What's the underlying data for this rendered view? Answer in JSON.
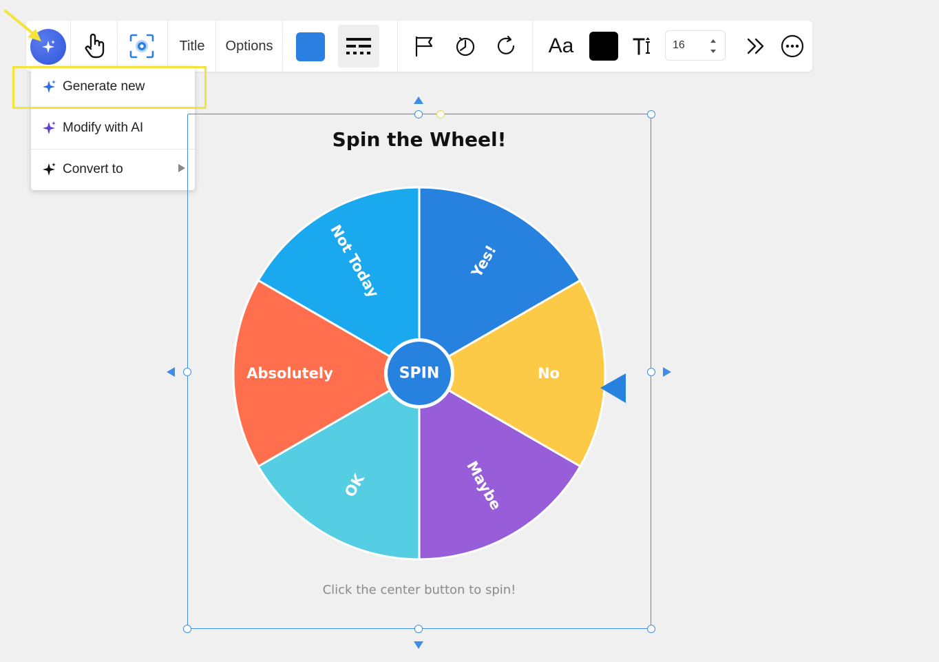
{
  "toolbar": {
    "ai_button_icon": "sparkle-icon",
    "pointer_icon": "hand-pointer-icon",
    "focus_icon": "focus-target-icon",
    "title_label": "Title",
    "options_label": "Options",
    "fill_color": "#2a7fe0",
    "line_style_icon": "line-style-icon",
    "flag_icon": "flag-icon",
    "timer_icon": "timer-icon",
    "redo_icon": "rotate-icon",
    "font_label": "Aa",
    "text_color": "#000000",
    "text_size_icon": "text-size-icon",
    "font_size_value": "16",
    "more_icon": "chevrons-right-icon",
    "overflow_icon": "more-horizontal-icon"
  },
  "dropdown": {
    "items": [
      {
        "label": "Generate new",
        "icon": "sparkle-icon"
      },
      {
        "label": "Modify with AI",
        "icon": "sparkle-icon"
      },
      {
        "label": "Convert to",
        "icon": "sparkle-icon"
      }
    ]
  },
  "wheel": {
    "title": "Spin the Wheel!",
    "center_label": "SPIN",
    "caption": "Click the center button to spin!",
    "segments": [
      {
        "label": "Yes!",
        "color": "#2781df"
      },
      {
        "label": "No",
        "color": "#fdca47"
      },
      {
        "label": "Maybe",
        "color": "#985dd9"
      },
      {
        "label": "OK",
        "color": "#55cee3"
      },
      {
        "label": "Absolutely",
        "color": "#ff6f4d"
      },
      {
        "label": "Not Today",
        "color": "#1aa8ef"
      }
    ],
    "center_color": "#2781df",
    "pointer_color": "#2781df"
  },
  "colors": {
    "selection": "#3d8ee6",
    "highlight": "#f3e33a"
  }
}
